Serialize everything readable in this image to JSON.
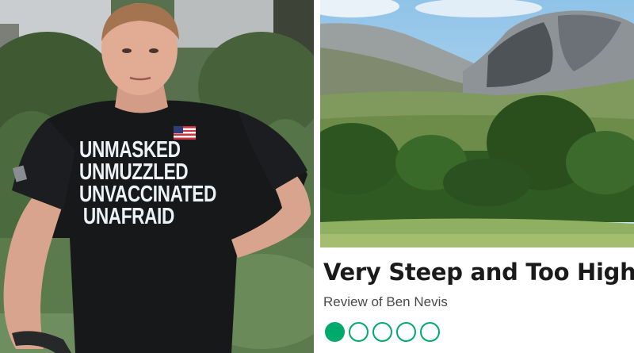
{
  "shirt": {
    "lines": [
      "UNMASKED",
      "UNMUZZLED",
      "UNVACCINATED",
      "UNAFRAID"
    ]
  },
  "review": {
    "title": "Very Steep and Too High",
    "subtitle": "Review of Ben Nevis",
    "rating_value": 1,
    "rating_max": 5,
    "accent_color": "#00aa6c"
  }
}
